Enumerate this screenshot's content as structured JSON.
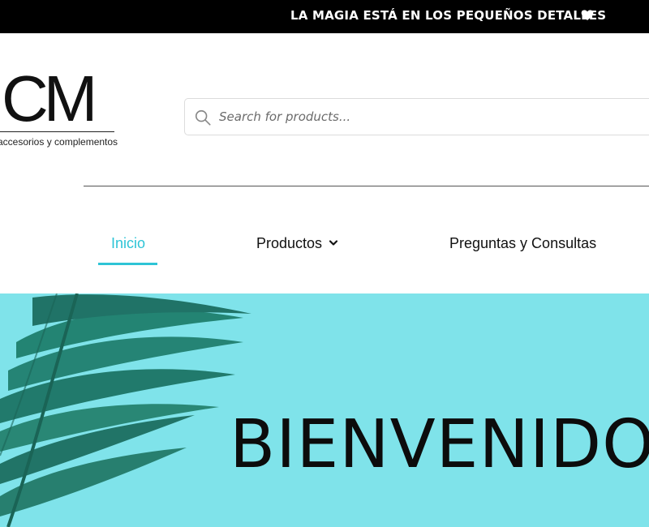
{
  "announcement": {
    "text": "LA MAGIA ESTÁ EN LOS PEQUEÑOS DETALLES",
    "icon": "heart-icon"
  },
  "logo": {
    "mark": "CM",
    "tagline": "accesorios y complementos"
  },
  "search": {
    "placeholder": "Search for products...",
    "value": "",
    "icon": "search-icon"
  },
  "nav": {
    "items": [
      {
        "label": "Inicio",
        "active": true
      },
      {
        "label": "Productos",
        "has_dropdown": true
      },
      {
        "label": "Preguntas y Consultas"
      }
    ]
  },
  "hero": {
    "title": "BIENVENIDOS"
  },
  "colors": {
    "accent": "#2ec4d6",
    "hero_bg": "#7fe3ea",
    "leaf": "#1f7f6d",
    "topbar_bg": "#000000"
  }
}
